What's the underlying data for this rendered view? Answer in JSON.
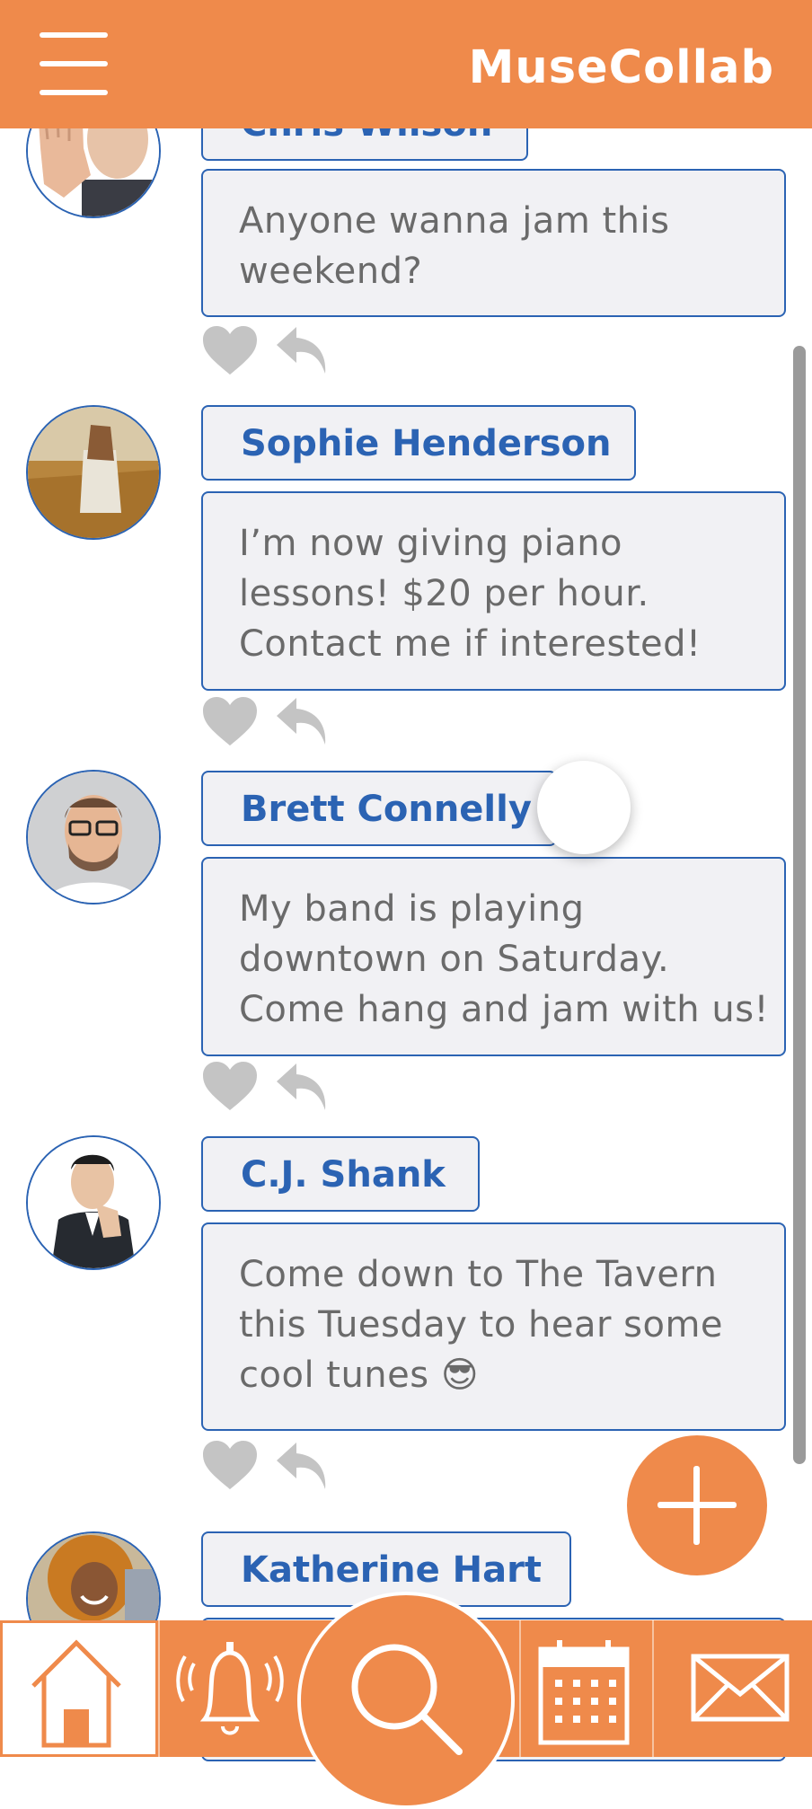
{
  "app": {
    "title": "MuseCollab"
  },
  "colors": {
    "accent": "#ef8a4b",
    "name_blue": "#2b63b3",
    "card_bg": "#f1f1f4",
    "icon_grey": "#c4c4c4"
  },
  "posts": [
    {
      "author": "Chris Wilson",
      "message": "Anyone wanna jam this weekend?",
      "avatar_icon": "avatar-photo-hand"
    },
    {
      "author": "Sophie Henderson",
      "message": "I’m now giving piano lessons! $20 per hour. Contact me if interested!",
      "avatar_icon": "avatar-photo-field"
    },
    {
      "author": "Brett Connelly",
      "message": "My band is playing downtown on Saturday. Come hang and jam with us!",
      "avatar_icon": "avatar-photo-glasses"
    },
    {
      "author": "C.J. Shank",
      "message": "Come down to The Tavern this Tuesday to hear some cool tunes 😎",
      "avatar_icon": "avatar-photo-suit"
    },
    {
      "author": "Katherine Hart",
      "message": "",
      "avatar_icon": "avatar-photo-curly"
    }
  ],
  "actions": {
    "like_icon": "heart-icon",
    "reply_icon": "reply-arrow-icon",
    "compose_icon": "plus-icon"
  },
  "nav": [
    {
      "icon": "home-icon",
      "active": true
    },
    {
      "icon": "bell-icon",
      "active": false
    },
    {
      "icon": "search-icon",
      "active": false
    },
    {
      "icon": "calendar-icon",
      "active": false
    },
    {
      "icon": "mail-icon",
      "active": false
    }
  ]
}
